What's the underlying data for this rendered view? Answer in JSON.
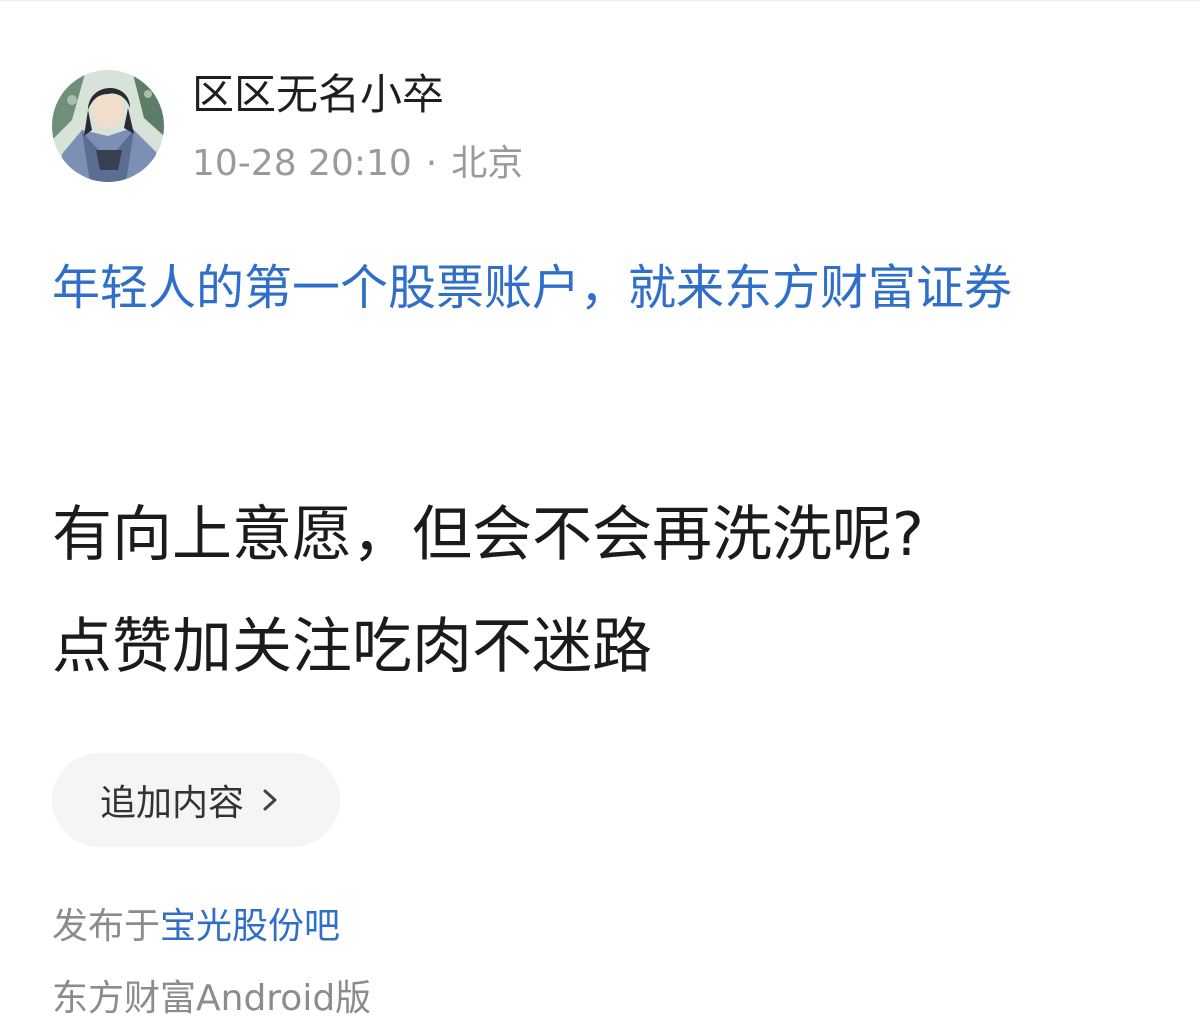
{
  "author": {
    "name": "区区无名小卒",
    "avatar_icon": "user-avatar"
  },
  "post_meta": {
    "time": "10-28 20:10",
    "separator": "·",
    "location": "北京"
  },
  "promo_link": {
    "text": "年轻人的第一个股票账户，就来东方财富证券"
  },
  "post": {
    "lines": [
      "有向上意愿，但会不会再洗洗呢?",
      "点赞加关注吃肉不迷路"
    ]
  },
  "append_button": {
    "label": "追加内容",
    "icon": "chevron-right-icon"
  },
  "posted_in": {
    "prefix": "发布于",
    "forum": "宝光股份吧"
  },
  "client": {
    "text": "东方财富Android版"
  },
  "colors": {
    "link": "#2f6fc9",
    "text_primary": "#1b1b1b",
    "text_secondary": "#9a9a9a",
    "button_bg": "#f4f5f7"
  }
}
